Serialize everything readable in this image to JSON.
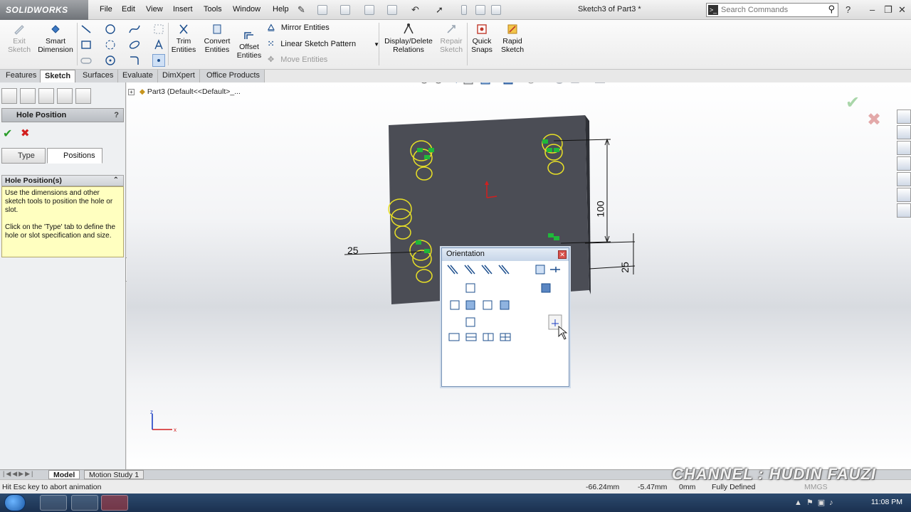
{
  "app": {
    "logo_text": "SOLIDWORKS",
    "doc_title": "Sketch3 of Part3 *"
  },
  "menu": [
    "File",
    "Edit",
    "View",
    "Insert",
    "Tools",
    "Window",
    "Help"
  ],
  "search": {
    "placeholder": "Search Commands"
  },
  "commands": {
    "exit_sketch": "Exit Sketch",
    "smart_dimension": "Smart Dimension",
    "trim_entities": "Trim Entities",
    "convert_entities": "Convert Entities",
    "offset_entities": "Offset Entities",
    "mirror_entities": "Mirror Entities",
    "linear_sketch_pattern": "Linear Sketch Pattern",
    "move_entities": "Move Entities",
    "display_delete_relations": "Display/Delete Relations",
    "repair_sketch": "Repair Sketch",
    "quick_snaps": "Quick Snaps",
    "rapid_sketch": "Rapid Sketch"
  },
  "tabs": [
    "Features",
    "Sketch",
    "Surfaces",
    "Evaluate",
    "DimXpert",
    "Office Products"
  ],
  "active_tab": "Sketch",
  "property_manager": {
    "title": "Hole Position",
    "tab_type": "Type",
    "tab_positions": "Positions",
    "group_title": "Hole Position(s)",
    "help_text_1": "Use the dimensions and other sketch tools to position the hole or slot.",
    "help_text_2": "Click on the 'Type' tab to define the hole or slot specification and size."
  },
  "feature_tree": {
    "root": "Part3  (Default<<Default>_..."
  },
  "dimensions": {
    "horizontal": "25",
    "vertical_long": "100",
    "vertical_short": "25"
  },
  "orientation_dialog": {
    "title": "Orientation"
  },
  "bottom_tabs": [
    "Model",
    "Motion Study 1"
  ],
  "status": {
    "message": "Hit Esc key to abort animation",
    "x": "-66.24mm",
    "y": "-5.47mm",
    "z": "0mm",
    "state": "Fully Defined",
    "units": "MMGS"
  },
  "watermark": "CHANNEL : HUDIN FAUZI",
  "clock": "11:08 PM",
  "colors": {
    "accent": "#2f8f3a",
    "block": "#4b4d55",
    "hole": "#e8e026",
    "relation": "#1fb83a",
    "help_bg": "#ffffc0"
  }
}
